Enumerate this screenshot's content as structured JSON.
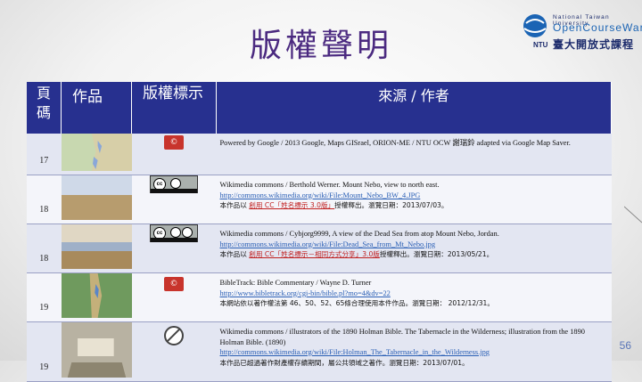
{
  "slide": {
    "title": "版權聲明",
    "page_number": "56"
  },
  "logo": {
    "university": "National Taiwan University",
    "opencourseware": "OpenCourseWare",
    "chinese": "臺大開放式課程",
    "ntu": "NTU"
  },
  "table": {
    "headers": {
      "page": "頁碼",
      "work": "作品",
      "license": "版權標示",
      "source": "來源 / 作者"
    },
    "rows": [
      {
        "page": "17",
        "license_icon": "public-domain-mark",
        "source_line1": "Powered by Google / 2013 Google, Maps GISrael, ORION-ME / NTU OCW 謝瑞鈴 adapted via Google Map Saver.",
        "link": "",
        "source_line3": ""
      },
      {
        "page": "18",
        "license_icon": "cc-by-badge",
        "source_line1": "Wikimedia commons / Berthold Werner. Mount Nebo, view to north east.",
        "link": "http://commons.wikimedia.org/wiki/File:Mount_Nebo_BW_4.JPG",
        "source_line3a": "本作品以 ",
        "source_line3_link": "創用 CC「姓名標示 3.0版」",
        "source_line3b": "授權釋出。瀏覽日期：2013/07/03。"
      },
      {
        "page": "18",
        "license_icon": "cc-by-sa-badge",
        "source_line1": "Wikimedia commons / Cybjorg9999, A view of the Dead Sea from atop Mount Nebo, Jordan.",
        "link": "http://commons.wikimedia.org/wiki/File:Dead_Sea_from_Mt_Nebo.jpg",
        "source_line3a": "本作品以 ",
        "source_line3_link": "創用 CC「姓名標示－相同方式分享」3.0版",
        "source_line3b": "授權釋出。瀏覽日期：2013/05/21。"
      },
      {
        "page": "19",
        "license_icon": "fair-use-mark",
        "source_line1": "BibleTrack: Bible Commentary / Wayne D. Turner",
        "link": "http://www.bibletrack.org/cgi-bin/bible.pl?mo=4&dv=22",
        "source_line3a": "本網站依以著作權法第 46、50、52、65條合理使用本件作品。瀏覽日期： 2012/12/31。",
        "source_line3_link": "",
        "source_line3b": ""
      },
      {
        "page": "19",
        "license_icon": "no-copyright-icon",
        "source_line1": "Wikimedia commons / illustrators of the 1890 Holman Bible. The Tabernacle in the Wilderness; illustration from the 1890 Holman Bible. (1890)",
        "link": "http://commons.wikimedia.org/wiki/File:Holman_The_Tabernacle_in_the_Wilderness.jpg",
        "source_line3a": "本作品已超過著作財產權存續期間，屬公共領域之著作。瀏覽日期：2013/07/01。",
        "source_line3_link": "",
        "source_line3b": ""
      }
    ]
  },
  "colors": {
    "header_bg": "#27308f",
    "title": "#4b2a80",
    "link": "#2a5fb5"
  }
}
